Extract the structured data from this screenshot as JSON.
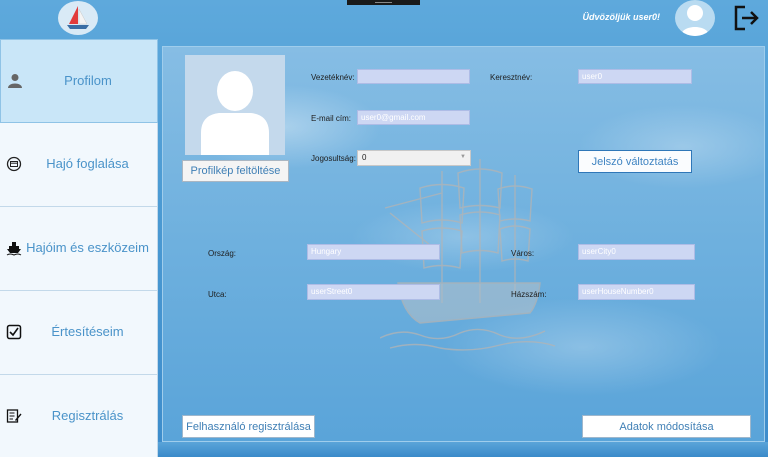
{
  "header": {
    "welcome": "Üdvözöljük user0!"
  },
  "sidebar": {
    "items": [
      {
        "label": "Profilom",
        "icon": "user-icon",
        "active": true
      },
      {
        "label": "Hajó foglalása",
        "icon": "calendar-icon",
        "active": false
      },
      {
        "label": "Hajóim és eszközeim",
        "icon": "ship-icon",
        "active": false
      },
      {
        "label": "Értesítéseim",
        "icon": "checkbox-icon",
        "active": false
      },
      {
        "label": "Regisztrálás",
        "icon": "edit-icon",
        "active": false
      }
    ]
  },
  "profile": {
    "upload_button": "Profilkép feltöltése",
    "lastname_label": "Vezetéknév:",
    "lastname_value": "",
    "firstname_label": "Keresztnév:",
    "firstname_value": "user0",
    "email_label": "E-mail cím:",
    "email_value": "user0@gmail.com",
    "role_label": "Jogosultság:",
    "role_value": "0",
    "password_button": "Jelszó változtatás",
    "country_label": "Ország:",
    "country_value": "Hungary",
    "city_label": "Város:",
    "city_value": "userCity0",
    "street_label": "Utca:",
    "street_value": "userStreet0",
    "house_label": "Házszám:",
    "house_value": "userHouseNumber0",
    "register_button": "Felhasználó regisztrálása",
    "modify_button": "Adatok módosítása"
  },
  "colors": {
    "accent": "#4a93c9",
    "active_nav": "#c9e6f8",
    "field_bg": "#cdd7f3"
  }
}
